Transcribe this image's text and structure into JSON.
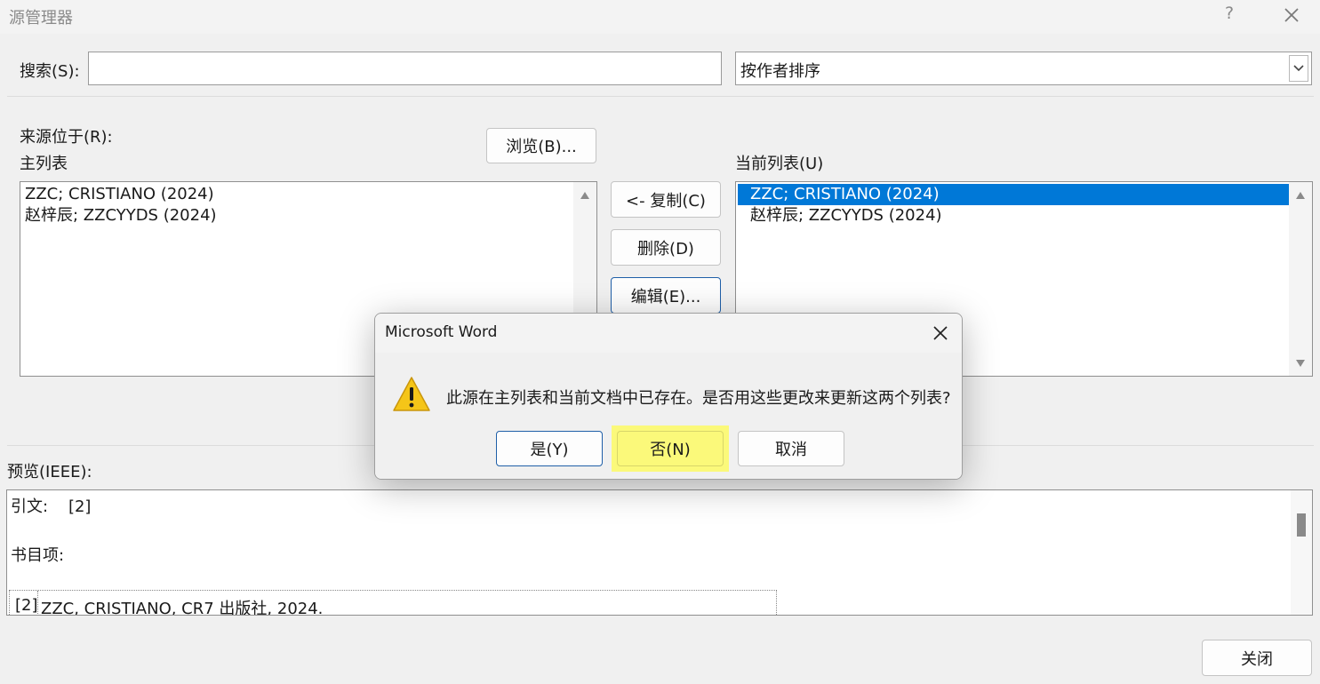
{
  "window": {
    "title": "源管理器",
    "help": "?"
  },
  "search": {
    "label": "搜索(S):",
    "value": "",
    "placeholder": ""
  },
  "sort": {
    "selected": "按作者排序"
  },
  "source": {
    "location_label": "来源位于(R):",
    "browse_label": "浏览(B)...",
    "master_label": "主列表",
    "current_label": "当前列表(U)"
  },
  "master_list": {
    "items": [
      "ZZC; CRISTIANO (2024)",
      "赵梓辰; ZZCYYDS (2024)"
    ]
  },
  "current_list": {
    "items": [
      "ZZC; CRISTIANO (2024)",
      "赵梓辰; ZZCYYDS (2024)"
    ],
    "selected_index": 0
  },
  "actions": {
    "copy": "<- 复制(C)",
    "delete": "删除(D)",
    "edit": "编辑(E)..."
  },
  "preview": {
    "label": "预览(IEEE):",
    "citation": "引文:    [2]",
    "bib_label": "书目项:",
    "entry_num": "[2]",
    "entry_text": "ZZC, CRISTIANO, CR7 出版社, 2024."
  },
  "footer": {
    "close": "关闭"
  },
  "dialog": {
    "title": "Microsoft Word",
    "message": "此源在主列表和当前文档中已存在。是否用这些更改来更新这两个列表?",
    "yes": "是(Y)",
    "no": "否(N)",
    "cancel": "取消"
  },
  "colors": {
    "selection": "#0078d7",
    "highlight": "#fbf97a",
    "accent_border": "#1f5fa8"
  }
}
